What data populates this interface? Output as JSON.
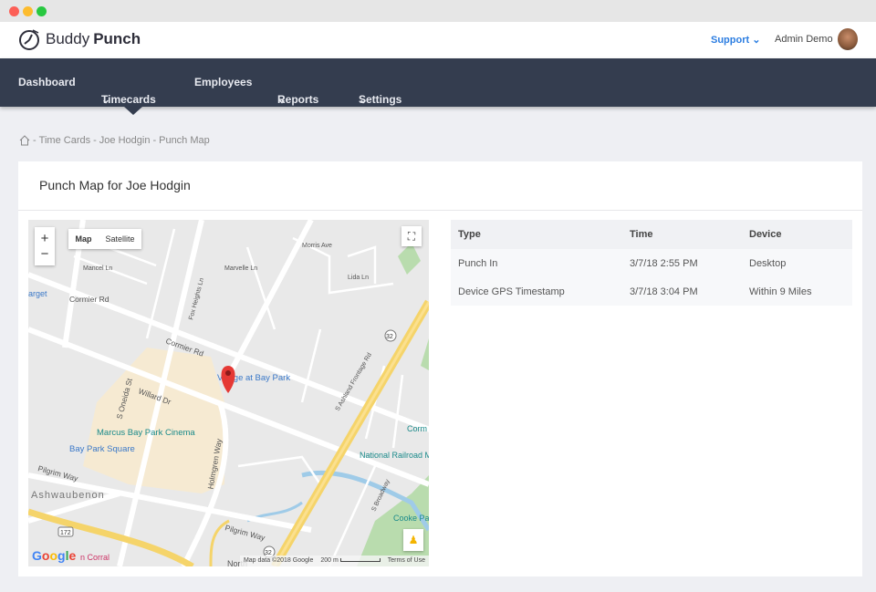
{
  "brand": {
    "word1": "Buddy",
    "word2": "Punch"
  },
  "header": {
    "support": "Support",
    "user": "Admin Demo"
  },
  "nav": [
    {
      "label": "Dashboard"
    },
    {
      "label": "Timecards"
    },
    {
      "label": "Employees"
    },
    {
      "label": "Reports"
    },
    {
      "label": "Settings"
    }
  ],
  "breadcrumb": {
    "sep": "-",
    "items": [
      "Time Cards",
      "Joe Hodgin",
      "Punch Map"
    ]
  },
  "card": {
    "title": "Punch Map for Joe Hodgin"
  },
  "map": {
    "type_map": "Map",
    "type_satellite": "Satellite",
    "zoom_in": "+",
    "zoom_out": "−",
    "google": "Google",
    "footer": {
      "data": "Map data ©2018 Google",
      "scale": "200 m",
      "terms": "Terms of Use"
    },
    "labels": [
      "Cormier Rd",
      "Cormier Rd",
      "S Oneida St",
      "Willard Dr",
      "Holmgren Way",
      "Village at Bay Park",
      "Marcus Bay Park Cinema",
      "Bay Park Square",
      "Pilgrim Way",
      "Pilgrim Way",
      "Ashwaubenon",
      "National Railroad Museum",
      "Cooke Pa",
      "Morris Ave",
      "Marvelle Ln",
      "Lida Ln",
      "Mancel Ln",
      "Fox Heights Ln",
      "S Ashland Frontage Rd",
      "S Broadway",
      "Corm",
      "North",
      "arget",
      "n Corral",
      "32",
      "172"
    ]
  },
  "colors": {
    "nav": "#343d4f",
    "accent": "#2b7de1",
    "pin": "#e53935"
  },
  "table": {
    "headers": [
      "Type",
      "Time",
      "Device"
    ],
    "rows": [
      [
        "Punch In",
        "3/7/18 2:55 PM",
        "Desktop"
      ],
      [
        "Device GPS Timestamp",
        "3/7/18 3:04 PM",
        "Within 9 Miles"
      ]
    ]
  }
}
